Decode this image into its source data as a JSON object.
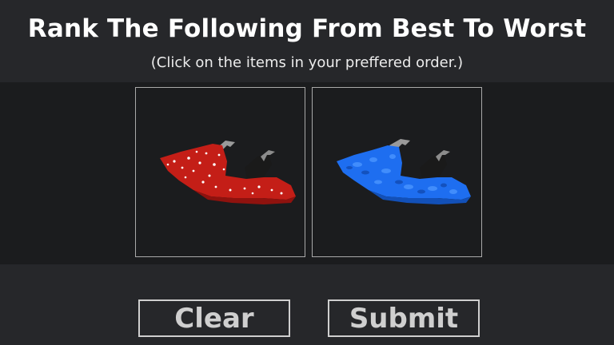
{
  "header": {
    "title": "Rank The Following From Best To Worst",
    "subtitle": "(Click on the items in your preffered order.)"
  },
  "items": [
    {
      "icon": "red-jetski-icon",
      "color": "#c41e17"
    },
    {
      "icon": "blue-jetski-icon",
      "color": "#1e6ef0"
    }
  ],
  "buttons": {
    "clear_label": "Clear",
    "submit_label": "Submit"
  }
}
